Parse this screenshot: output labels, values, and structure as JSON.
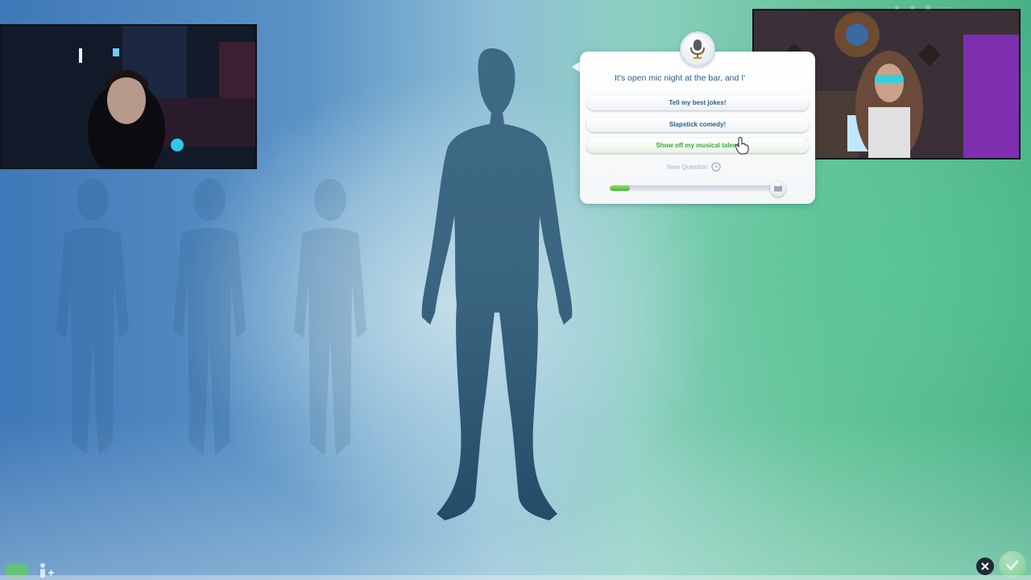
{
  "dialog": {
    "icon": "microphone-icon",
    "question": "It's open mic night at the bar, and I'",
    "answers": [
      "Tell my best jokes!",
      "Slapstick comedy!",
      "Show off my musical talent"
    ],
    "hovered_answer_index": 2,
    "new_question_label": "New Question",
    "progress_fraction": 0.12,
    "progress_end_icon": "book-icon"
  },
  "webcams": {
    "left": "webcam-feed-streamer-1",
    "right": "webcam-feed-streamer-2"
  },
  "controls": {
    "close_icon": "close-icon",
    "confirm_icon": "checkmark-icon",
    "add_sim_icon": "add-sim-icon"
  },
  "colors": {
    "accent_blue": "#2b5d8f",
    "hover_green": "#3ea83e",
    "progress_green": "#4cb43c"
  }
}
